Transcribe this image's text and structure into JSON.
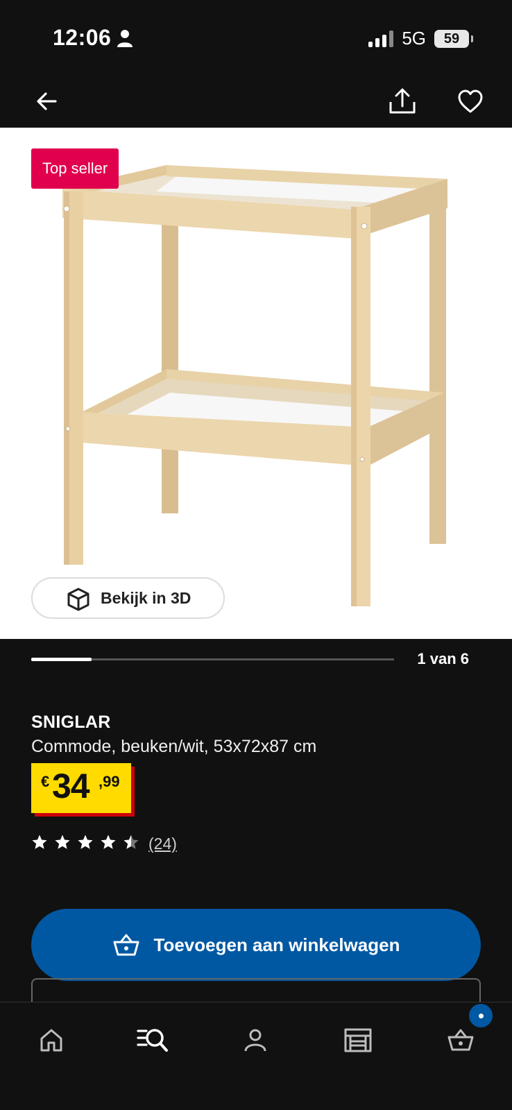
{
  "status_bar": {
    "time": "12:06",
    "network": "5G",
    "battery": "59"
  },
  "header": {
    "back_icon": "arrow-left-icon",
    "share_icon": "share-icon",
    "favorite_icon": "heart-icon"
  },
  "gallery": {
    "badge": "Top seller",
    "view_3d_label": "Bekijk in 3D",
    "pager_text": "1 van 6",
    "progress_fraction": 0.167
  },
  "product": {
    "name": "SNIGLAR",
    "description": "Commode, beuken/wit, 53x72x87 cm",
    "price_currency": "€",
    "price_integer": "34",
    "price_decimal": ",99",
    "rating": 4.5,
    "rating_max": 5,
    "review_count": "(24)"
  },
  "cta": {
    "label": "Toevoegen aan winkelwagen",
    "icon": "basket-icon"
  },
  "tab_bar": {
    "items": [
      {
        "icon": "home-icon"
      },
      {
        "icon": "search-list-icon"
      },
      {
        "icon": "profile-icon"
      },
      {
        "icon": "store-icon"
      },
      {
        "icon": "cart-icon"
      }
    ]
  },
  "colors": {
    "accent_blue": "#0058a3",
    "badge_red": "#e0004d",
    "price_yellow": "#ffdb00",
    "price_shadow_red": "#cc0008"
  }
}
